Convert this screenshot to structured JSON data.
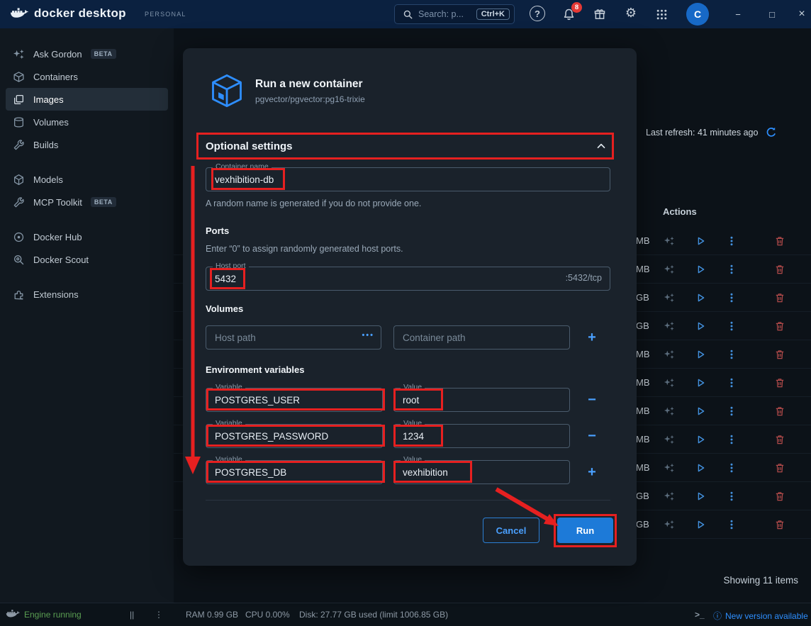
{
  "titlebar": {
    "app_name": "docker desktop",
    "plan_label": "PERSONAL",
    "search_placeholder": "Search: p...",
    "search_shortcut": "Ctrl+K",
    "help_glyph": "?",
    "notification_count": "8",
    "avatar_initial": "C",
    "minimize_glyph": "−",
    "maximize_glyph": "□",
    "close_glyph": "×"
  },
  "sidebar": {
    "items": [
      {
        "label": "Ask Gordon",
        "badge": "BETA"
      },
      {
        "label": "Containers"
      },
      {
        "label": "Images"
      },
      {
        "label": "Volumes"
      },
      {
        "label": "Builds"
      },
      {
        "label": "Models"
      },
      {
        "label": "MCP Toolkit",
        "badge": "BETA"
      },
      {
        "label": "Docker Hub"
      },
      {
        "label": "Docker Scout"
      },
      {
        "label": "Extensions"
      }
    ]
  },
  "images_page": {
    "last_refresh": "Last refresh: 41 minutes ago",
    "actions_header": "Actions",
    "showing_label": "Showing 11 items",
    "rows": [
      {
        "size": "MB"
      },
      {
        "size": "MB"
      },
      {
        "size": "GB"
      },
      {
        "size": "GB"
      },
      {
        "size": "MB"
      },
      {
        "size": "MB"
      },
      {
        "size": "MB"
      },
      {
        "size": "MB"
      },
      {
        "size": "MB"
      },
      {
        "size": "GB"
      },
      {
        "size": "GB"
      }
    ]
  },
  "modal": {
    "title": "Run a new container",
    "image_ref": "pgvector/pgvector:pg16-trixie",
    "optional_settings_label": "Optional settings",
    "container_name": {
      "label": "Container name",
      "value": "vexhibition-db",
      "helper": "A random name is generated if you do not provide one."
    },
    "ports": {
      "heading": "Ports",
      "helper": "Enter “0” to assign randomly generated host ports.",
      "host_port_label": "Host port",
      "host_port_value": "5432",
      "container_port_suffix": ":5432/tcp"
    },
    "volumes": {
      "heading": "Volumes",
      "host_path_placeholder": "Host path",
      "container_path_placeholder": "Container path"
    },
    "env": {
      "heading": "Environment variables",
      "variable_label": "Variable",
      "value_label": "Value",
      "rows": [
        {
          "variable": "POSTGRES_USER",
          "value": "root"
        },
        {
          "variable": "POSTGRES_PASSWORD",
          "value": "1234"
        },
        {
          "variable": "POSTGRES_DB",
          "value": "vexhibition"
        }
      ]
    },
    "cancel_label": "Cancel",
    "run_label": "Run"
  },
  "statusbar": {
    "engine_status": "Engine running",
    "ram": "RAM 0.99 GB",
    "cpu": "CPU 0.00%",
    "disk": "Disk: 27.77 GB used (limit 1006.85 GB)",
    "terminal_glyph": ">_",
    "update_label": "New version available"
  },
  "icons": {
    "minus": "−",
    "plus": "+",
    "dots": "•••",
    "pause": "||",
    "kebab": "⋮",
    "gear": "⚙",
    "info": "ⓘ"
  }
}
